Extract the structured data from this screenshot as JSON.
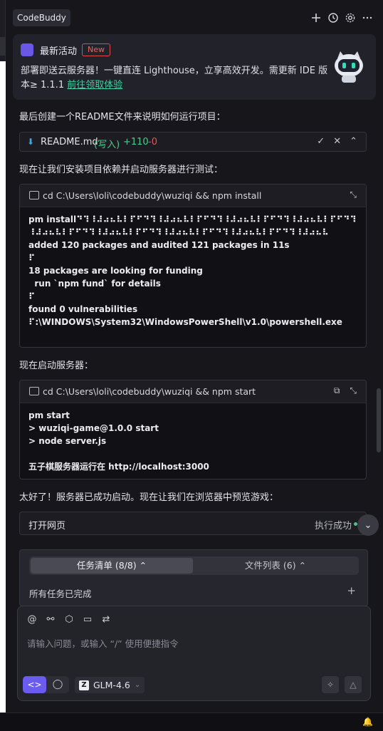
{
  "app": {
    "title": "CodeBuddy"
  },
  "toolbar": {
    "new_chat_icon": "plus-icon",
    "history_icon": "history-icon",
    "settings_icon": "gear-icon",
    "more_icon": "more-icon"
  },
  "announcement": {
    "title": "最新活动",
    "badge": "New",
    "description": "部署即送云服务器！一键直连 Lighthouse，立享高效开发。需更新 IDE 版本≥ 1.1.1 ",
    "link_text": "前往领取体验"
  },
  "messages": {
    "m1": "最后创建一个README文件来说明如何运行项目：",
    "m2": "现在让我们安装项目依赖并启动服务器进行测试：",
    "m3": "现在启动服务器：",
    "m4": "太好了！服务器已成功启动。现在让我们在浏览器中预览游戏："
  },
  "file_change": {
    "name": "README.md",
    "mode": "(写入)",
    "added": "+110",
    "removed": "-0"
  },
  "terminal1": {
    "command": "cd C:\\Users\\loli\\codebuddy\\wuziqi && npm install",
    "output": "pm install⠙⠹⠸⠼⠴⠦⠧⠇⠏⠋⠙⠹⠸⠼⠴⠦⠧⠇⠏⠋⠙⠹⠸⠼⠴⠦⠧⠇⠏⠋⠙⠹⠸⠼⠴⠦⠧⠇⠏⠋⠙⠹⠸⠼⠴⠦⠧⠇⠏⠋⠙⠹⠸⠼⠴⠦⠧⠇⠏⠋⠙⠹⠸⠼⠴⠦⠧⠇⠏⠋⠙⠹⠸⠼⠴⠦⠧⠇⠏⠋⠙⠹⠸⠼⠴⠦⠧\nadded 120 packages and audited 121 packages in 11s\n⠏\n18 packages are looking for funding\n  run `npm fund` for details\n⠏\nfound 0 vulnerabilities\n⠏:\\WINDOWS\\System32\\WindowsPowerShell\\v1.0\\powershell.exe"
  },
  "terminal2": {
    "command": "cd C:\\Users\\loli\\codebuddy\\wuziqi && npm start",
    "output": "pm start\n> wuziqi-game@1.0.0 start\n> node server.js\n\n五子棋服务器运行在 http://localhost:3000"
  },
  "open_page": {
    "label": "打开网页",
    "status": "执行成功"
  },
  "tasks": {
    "tab_tasks": "任务清单 (8/8)",
    "tab_files": "文件列表 (6)",
    "done_text": "所有任务已完成"
  },
  "composer": {
    "placeholder": "请输入问题，或输入 “/” 使用便捷指令",
    "model": "GLM-4.6"
  },
  "colors": {
    "accent": "#6b5cf0",
    "success": "#55c88c",
    "danger": "#e05757",
    "link": "#3fd0a0"
  }
}
